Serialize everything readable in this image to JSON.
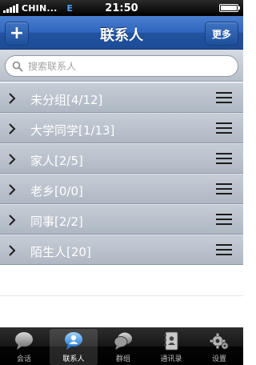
{
  "status_bar": {
    "carrier": "CHIN...",
    "network": "E",
    "time": "21:50"
  },
  "nav": {
    "title": "联系人",
    "add_label": "+",
    "more_label": "更多"
  },
  "search": {
    "placeholder": "搜索联系人"
  },
  "groups": [
    {
      "label": "未分组[4/12]"
    },
    {
      "label": "大学同学[1/13]"
    },
    {
      "label": "家人[2/5]"
    },
    {
      "label": "老乡[0/0]"
    },
    {
      "label": "同事[2/2]"
    },
    {
      "label": "陌生人[20]"
    }
  ],
  "tabs": [
    {
      "label": "会话",
      "icon": "chat-bubble-icon",
      "active": false
    },
    {
      "label": "联系人",
      "icon": "contacts-icon",
      "active": true
    },
    {
      "label": "群组",
      "icon": "group-icon",
      "active": false
    },
    {
      "label": "通讯录",
      "icon": "address-book-icon",
      "active": false
    },
    {
      "label": "设置",
      "icon": "gear-icon",
      "active": false
    }
  ],
  "colors": {
    "nav_blue": "#2f65be",
    "row_gray": "#b8c0cb",
    "tab_black": "#0a0a0a"
  }
}
